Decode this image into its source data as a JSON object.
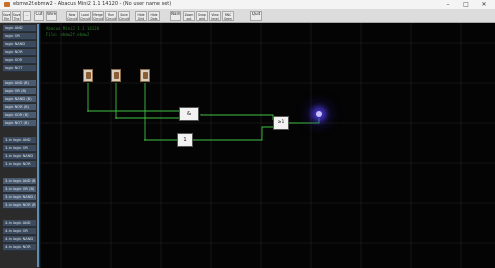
{
  "window": {
    "title": "ebmw2f.ebmw2 - Abacus Mini2 1.1 14120 - (No user name set)",
    "minimize": "–",
    "maximize": "□",
    "close": "✕"
  },
  "toolbar": {
    "buttons": [
      {
        "label": "Save\nFile"
      },
      {
        "label": "Save\nThe"
      },
      {
        "label": "…"
      },
      {
        "label": "Cut"
      },
      {
        "label": "Wire"
      },
      {
        "label": "New\nCircuit"
      },
      {
        "label": "Load\nCircuit"
      },
      {
        "label": "Merge\nCircuit"
      },
      {
        "label": "Run\nCircuit"
      },
      {
        "label": "Save\nCircuit"
      },
      {
        "label": "Hide\nGrid"
      },
      {
        "label": "Hide\nDots"
      },
      {
        "label": "Name"
      },
      {
        "label": "Zoom\nout"
      },
      {
        "label": "Snap\ngrid"
      },
      {
        "label": "View\nlevel"
      },
      {
        "label": "RNC\nSeen"
      },
      {
        "label": "Quit"
      }
    ]
  },
  "sidebar": {
    "items": [
      {
        "label": "logic AND"
      },
      {
        "label": "logic OR"
      },
      {
        "label": "logic NAND"
      },
      {
        "label": "logic NOR"
      },
      {
        "label": "logic XOR"
      },
      {
        "label": "logic NOT"
      },
      {
        "label": "logic AND (B)"
      },
      {
        "label": "logic OR (B)"
      },
      {
        "label": "logic NAND (B)"
      },
      {
        "label": "logic NOR (B)"
      },
      {
        "label": "logic XOR (B)"
      },
      {
        "label": "logic NOT (B)"
      },
      {
        "label": "3-in logic AND"
      },
      {
        "label": "3-in logic OR"
      },
      {
        "label": "3-in logic NAND"
      },
      {
        "label": "3-in logic NOR"
      },
      {
        "label": "3-in logic AND (B)"
      },
      {
        "label": "3-in logic OR (B)"
      },
      {
        "label": "3-in logic NAND (B)"
      },
      {
        "label": "3-in logic NOR (B)"
      },
      {
        "label": "4-in logic AND"
      },
      {
        "label": "4-in logic OR"
      },
      {
        "label": "4-in logic NAND"
      },
      {
        "label": "4-in logic NOR"
      }
    ]
  },
  "canvas": {
    "info": [
      "Abacus Mini2 1.1 14120",
      "File: ebmw2f.ebmw2"
    ],
    "gates": [
      {
        "name": "and-gate",
        "symbol": "&"
      },
      {
        "name": "buffer-gate",
        "symbol": "1"
      },
      {
        "name": "or-gate",
        "symbol": "≥1"
      }
    ],
    "colors": {
      "wire": "#3fbf3f",
      "grid": "#2a2a2a",
      "lamp": "#6a5cff"
    }
  }
}
